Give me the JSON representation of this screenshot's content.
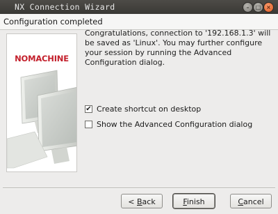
{
  "window": {
    "title": "NX Connection Wizard"
  },
  "header": {
    "heading": "Configuration completed"
  },
  "brand": {
    "logo_text": "NOMACHINE",
    "logo_color": "#c31f2b"
  },
  "message": "Congratulations, connection to '192.168.1.3' will be saved as 'Linux'. You may further configure your session by running the Advanced Configuration dialog.",
  "options": {
    "shortcut": {
      "label": "Create shortcut on desktop",
      "checked": true
    },
    "advanced": {
      "label": "Show the Advanced Configuration dialog",
      "checked": false
    }
  },
  "buttons": {
    "back": {
      "prefix": "< ",
      "mnemonic": "B",
      "rest": "ack"
    },
    "finish": {
      "mnemonic": "F",
      "rest": "inish"
    },
    "cancel": {
      "mnemonic": "C",
      "rest": "ancel"
    }
  },
  "icons": {
    "window_buttons": [
      "minimize-icon",
      "maximize-icon",
      "close-icon"
    ],
    "illustration": "computer-monitors-illustration"
  }
}
